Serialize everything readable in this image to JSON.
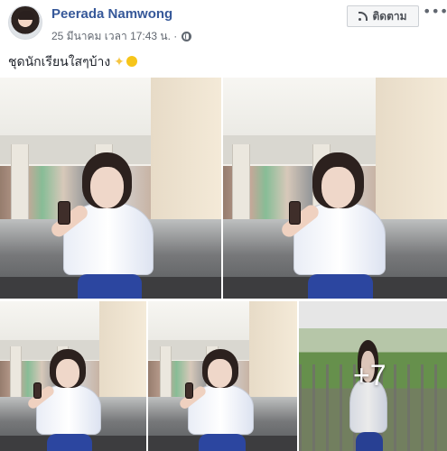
{
  "post": {
    "author": "Peerada Namwong",
    "timestamp": "25 มีนาคม เวลา 17:43 น. ·",
    "follow_label": "ติดตาม",
    "caption": "ชุดนักเรียนใสๆบ้าง",
    "more_label": "•••"
  },
  "media": {
    "remaining_count": "+7"
  },
  "icons": {
    "privacy": "globe-icon",
    "follow": "rss-icon",
    "menu": "more-icon"
  },
  "colors": {
    "link": "#365899",
    "meta": "#616770",
    "button_bg": "#f5f6f7"
  }
}
